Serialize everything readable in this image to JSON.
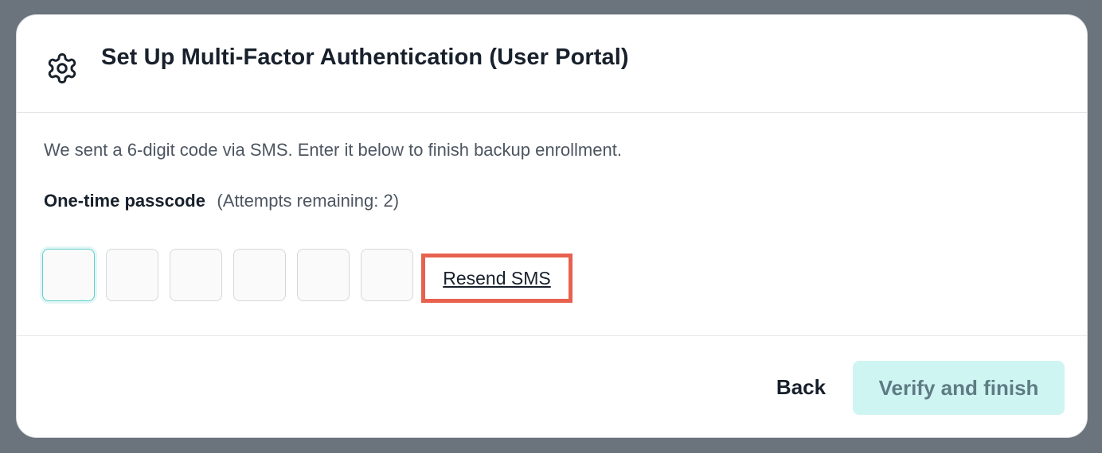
{
  "dialog": {
    "title": "Set Up Multi-Factor Authentication (User Portal)",
    "icon": "gear-icon"
  },
  "content": {
    "description": "We sent a 6-digit code via SMS. Enter it below to finish backup enrollment.",
    "otp_label": "One-time passcode",
    "attempts_text": "(Attempts remaining: 2)",
    "otp_digits": [
      "",
      "",
      "",
      "",
      "",
      ""
    ],
    "resend_label": "Resend SMS"
  },
  "footer": {
    "back_label": "Back",
    "verify_label": "Verify and finish"
  },
  "colors": {
    "accent": "#62d0cc",
    "primary_button_bg": "#cff5f3",
    "highlight_border": "#e8614f"
  }
}
